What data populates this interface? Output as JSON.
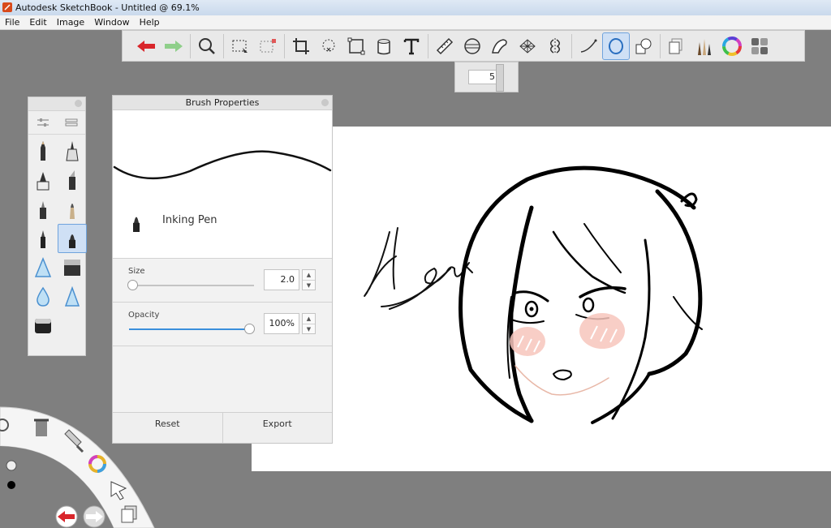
{
  "window": {
    "title": "Autodesk SketchBook - Untitled @ 69.1%"
  },
  "menu": [
    "File",
    "Edit",
    "Image",
    "Window",
    "Help"
  ],
  "toolbar": {
    "tools": [
      {
        "name": "undo-icon"
      },
      {
        "name": "redo-icon"
      },
      {
        "name": "zoom-icon"
      },
      {
        "name": "select-icon"
      },
      {
        "name": "transform-select-icon"
      },
      {
        "name": "crop-icon"
      },
      {
        "name": "lasso-icon"
      },
      {
        "name": "distort-icon"
      },
      {
        "name": "fill-icon"
      },
      {
        "name": "text-icon"
      },
      {
        "name": "ruler-icon"
      },
      {
        "name": "ellipse-guide-icon"
      },
      {
        "name": "french-curve-icon"
      },
      {
        "name": "perspective-icon"
      },
      {
        "name": "symmetry-icon"
      },
      {
        "name": "line-icon"
      },
      {
        "name": "ellipse-icon"
      },
      {
        "name": "shape-icon"
      },
      {
        "name": "layers-icon"
      },
      {
        "name": "brushes-icon"
      },
      {
        "name": "color-wheel-icon"
      },
      {
        "name": "copic-color-icon"
      }
    ],
    "active_tool": "ellipse-icon"
  },
  "brush_size_popup": {
    "value": "5"
  },
  "brush_properties": {
    "title": "Brush Properties",
    "brush_name": "Inking Pen",
    "size": {
      "label": "Size",
      "value": "2.0",
      "fraction": 0.02
    },
    "opacity": {
      "label": "Opacity",
      "value": "100%",
      "fraction": 1.0
    },
    "reset_label": "Reset",
    "export_label": "Export"
  },
  "colors": {
    "accent": "#3a8fdc",
    "selection": "#cfe0f5",
    "canvas_bg": "#ffffff",
    "workspace_bg": "#7f7f7f",
    "blush": "#f7c6bd"
  }
}
